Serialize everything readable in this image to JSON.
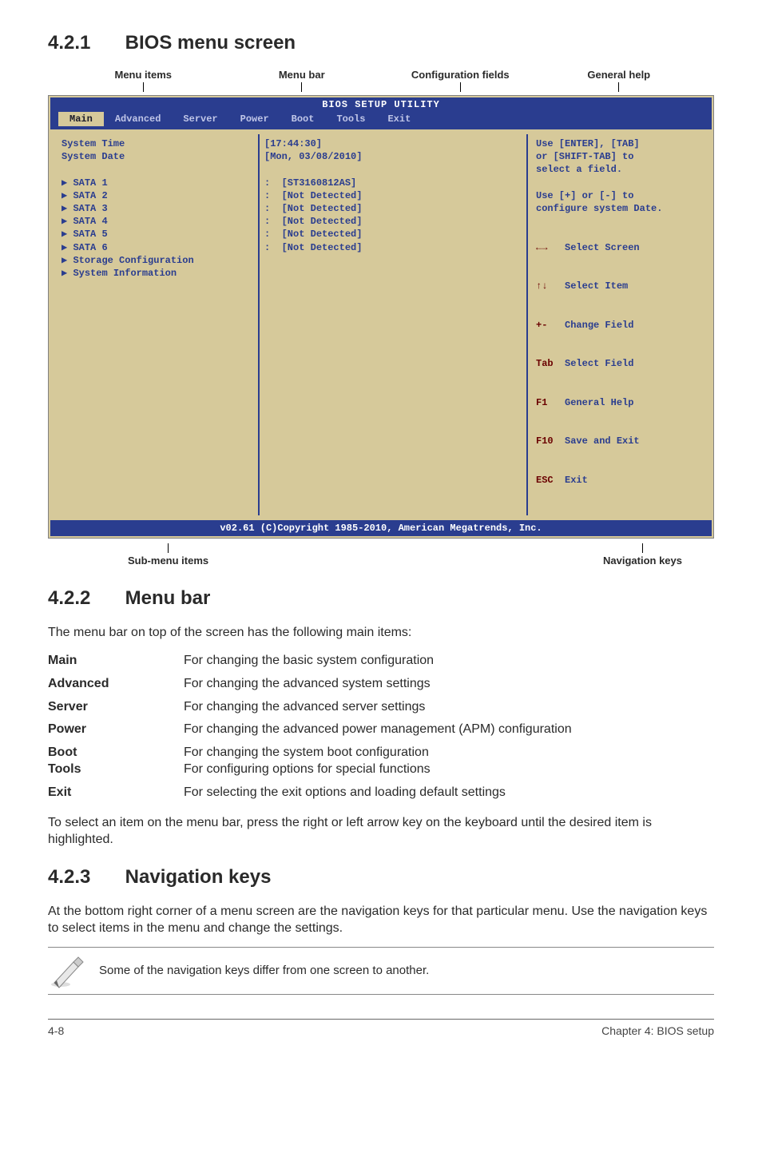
{
  "sections": {
    "s1": {
      "num": "4.2.1",
      "title": "BIOS menu screen"
    },
    "s2": {
      "num": "4.2.2",
      "title": "Menu bar"
    },
    "s3": {
      "num": "4.2.3",
      "title": "Navigation keys"
    }
  },
  "annot_top": {
    "a": "Menu items",
    "b": "Menu bar",
    "c": "Configuration fields",
    "d": "General help"
  },
  "annot_bottom": {
    "a": "Sub-menu items",
    "b": "Navigation keys"
  },
  "bios": {
    "title": "BIOS SETUP UTILITY",
    "tabs": [
      "Main",
      "Advanced",
      "Server",
      "Power",
      "Boot",
      "Tools",
      "Exit"
    ],
    "left": {
      "sys_time": "System Time",
      "sys_date": "System Date",
      "sata1": "SATA 1",
      "sata2": "SATA 2",
      "sata3": "SATA 3",
      "sata4": "SATA 4",
      "sata5": "SATA 5",
      "sata6": "SATA 6",
      "storage": "Storage Configuration",
      "sysinfo": "System Information"
    },
    "mid": {
      "time": "[17:44:30]",
      "date": "[Mon, 03/08/2010]",
      "v1": "[ST3160812AS]",
      "v2": "[Not Detected]",
      "v3": "[Not Detected]",
      "v4": "[Not Detected]",
      "v5": "[Not Detected]",
      "v6": "[Not Detected]"
    },
    "right": {
      "help1": "Use [ENTER], [TAB]",
      "help2": "or [SHIFT-TAB] to",
      "help3": "select a field.",
      "help4": "Use [+] or [-] to",
      "help5": "configure system Date.",
      "k1a": "←→",
      "k1b": "Select Screen",
      "k2a": "↑↓",
      "k2b": "Select Item",
      "k3a": "+-",
      "k3b": "Change Field",
      "k4a": "Tab",
      "k4b": "Select Field",
      "k5a": "F1",
      "k5b": "General Help",
      "k6a": "F10",
      "k6b": "Save and Exit",
      "k7a": "ESC",
      "k7b": "Exit"
    },
    "footer": "v02.61 (C)Copyright 1985-2010, American Megatrends, Inc."
  },
  "menubar_intro": "The menu bar on top of the screen has the following main items:",
  "menubar_items": {
    "r1k": "Main",
    "r1v": "For changing the basic system configuration",
    "r2k": "Advanced",
    "r2v": "For changing the advanced system settings",
    "r3k": "Server",
    "r3v": "For changing the advanced server settings",
    "r4k": "Power",
    "r4v": "For changing the advanced power management (APM) configuration",
    "r5k": "Boot",
    "r5v": "For changing the system boot configuration",
    "r6k": "Tools",
    "r6v": "For configuring options for special functions",
    "r7k": "Exit",
    "r7v": "For selecting the exit options and loading default settings"
  },
  "menubar_outro": "To select an item on the menu bar, press the right or left arrow key on the keyboard until the desired item is highlighted.",
  "navkeys_para": "At the bottom right corner of a menu screen are the navigation keys for that particular menu. Use the navigation keys to select items in the menu and change the settings.",
  "note_text": "Some of the navigation keys differ from one screen to another.",
  "footer": {
    "left": "4-8",
    "right": "Chapter 4: BIOS setup"
  }
}
